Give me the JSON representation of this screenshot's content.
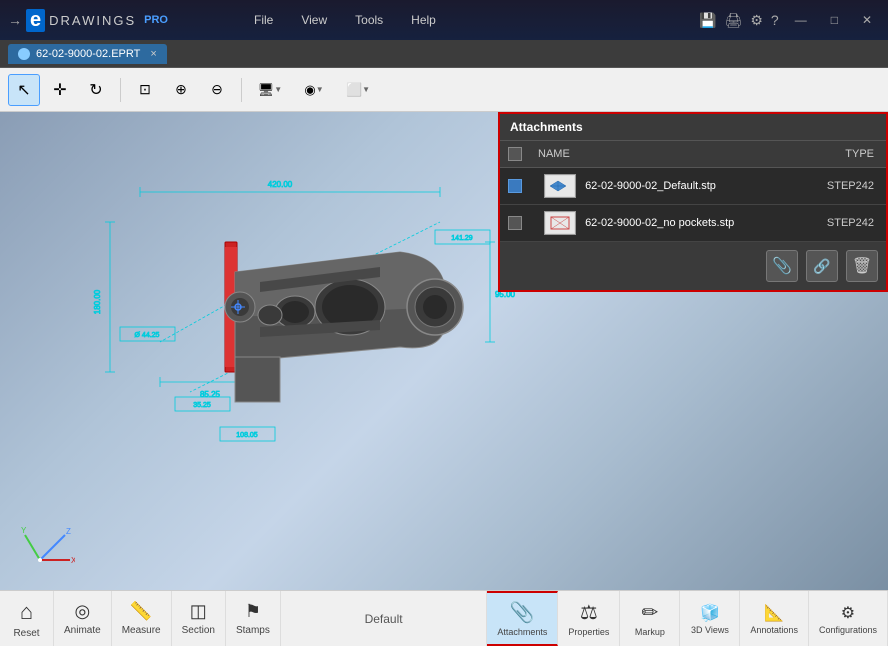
{
  "app": {
    "title": "eDrawings PRO",
    "logo_arrow": "→",
    "logo_e": "e",
    "logo_drawings": "DRAWINGS",
    "logo_pro": "PRO"
  },
  "menu": {
    "items": [
      "File",
      "View",
      "Tools",
      "Help"
    ]
  },
  "window_controls": {
    "minimize": "—",
    "maximize": "□",
    "close": "✕"
  },
  "tab": {
    "name": "62-02-9000-02.EPRT",
    "close": "×"
  },
  "toolbar": {
    "tools": [
      {
        "name": "select",
        "icon": "↖",
        "active": true
      },
      {
        "name": "move",
        "icon": "✛"
      },
      {
        "name": "rotate",
        "icon": "↻"
      },
      {
        "name": "zoom-fit",
        "icon": "⊡"
      },
      {
        "name": "zoom-area",
        "icon": "⊕"
      },
      {
        "name": "zoom-dynamic",
        "icon": "⊖"
      },
      {
        "name": "display-mode",
        "icon": "🖥",
        "has_arrow": true
      },
      {
        "name": "appearance",
        "icon": "◉",
        "has_arrow": true
      },
      {
        "name": "section-plane",
        "icon": "⬜",
        "has_arrow": true
      }
    ]
  },
  "viewport": {
    "background_start": "#8a9db5",
    "background_end": "#c5d5e8"
  },
  "attachments_panel": {
    "title": "Attachments",
    "columns": [
      "NAME",
      "TYPE"
    ],
    "rows": [
      {
        "checked": true,
        "filename": "62-02-9000-02_Default.stp",
        "type": "STEP242"
      },
      {
        "checked": false,
        "filename": "62-02-9000-02_no pockets.stp",
        "type": "STEP242"
      }
    ],
    "footer_buttons": [
      "📎",
      "🔗",
      "🗑"
    ]
  },
  "bottom_tools": {
    "left": [
      {
        "name": "reset",
        "label": "Reset",
        "icon": "⌂"
      },
      {
        "name": "animate",
        "label": "Animate",
        "icon": "◎"
      },
      {
        "name": "measure",
        "label": "Measure",
        "icon": "📏"
      },
      {
        "name": "section",
        "label": "Section",
        "icon": "◫"
      },
      {
        "name": "stamps",
        "label": "Stamps",
        "icon": "⚑"
      }
    ],
    "default_label": "Default",
    "right": [
      {
        "name": "attachments",
        "label": "Attachments",
        "icon": "📎",
        "active": true
      },
      {
        "name": "properties",
        "label": "Properties",
        "icon": "⚖"
      },
      {
        "name": "markup",
        "label": "Markup",
        "icon": "✏"
      },
      {
        "name": "3d-views",
        "label": "3D Views",
        "icon": "🧊"
      },
      {
        "name": "annotations",
        "label": "Annotations",
        "icon": "📐"
      },
      {
        "name": "configurations",
        "label": "Configurations",
        "icon": "⚙"
      }
    ]
  }
}
